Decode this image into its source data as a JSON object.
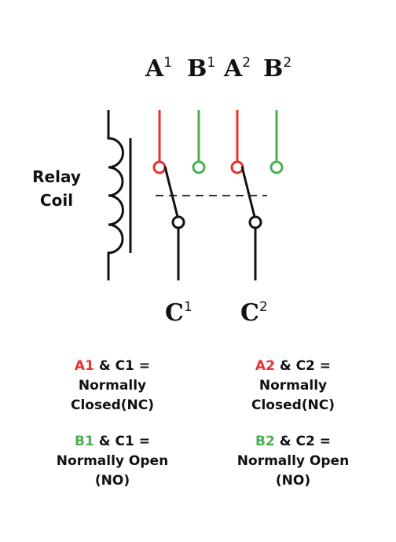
{
  "colors": {
    "nc": "#e8302c",
    "no": "#4caf50",
    "wire": "#111111"
  },
  "coil_label": [
    "Relay",
    "Coil"
  ],
  "terminals": [
    {
      "letter": "A",
      "index": "1"
    },
    {
      "letter": "B",
      "index": "1"
    },
    {
      "letter": "A",
      "index": "2"
    },
    {
      "letter": "B",
      "index": "2"
    }
  ],
  "commons": [
    {
      "letter": "C",
      "index": "1"
    },
    {
      "letter": "C",
      "index": "2"
    }
  ],
  "legend": [
    {
      "key": "A1",
      "rest": " & C1 =",
      "lines": [
        "Normally",
        "Closed(NC)"
      ]
    },
    {
      "key": "A2",
      "rest": " & C2 =",
      "lines": [
        "Normally",
        "Closed(NC)"
      ]
    },
    {
      "key": "B1",
      "rest": " & C1 =",
      "lines": [
        "Normally Open",
        "(NO)"
      ]
    },
    {
      "key": "B2",
      "rest": " & C2 =",
      "lines": [
        "Normally Open",
        "(NO)"
      ]
    }
  ]
}
